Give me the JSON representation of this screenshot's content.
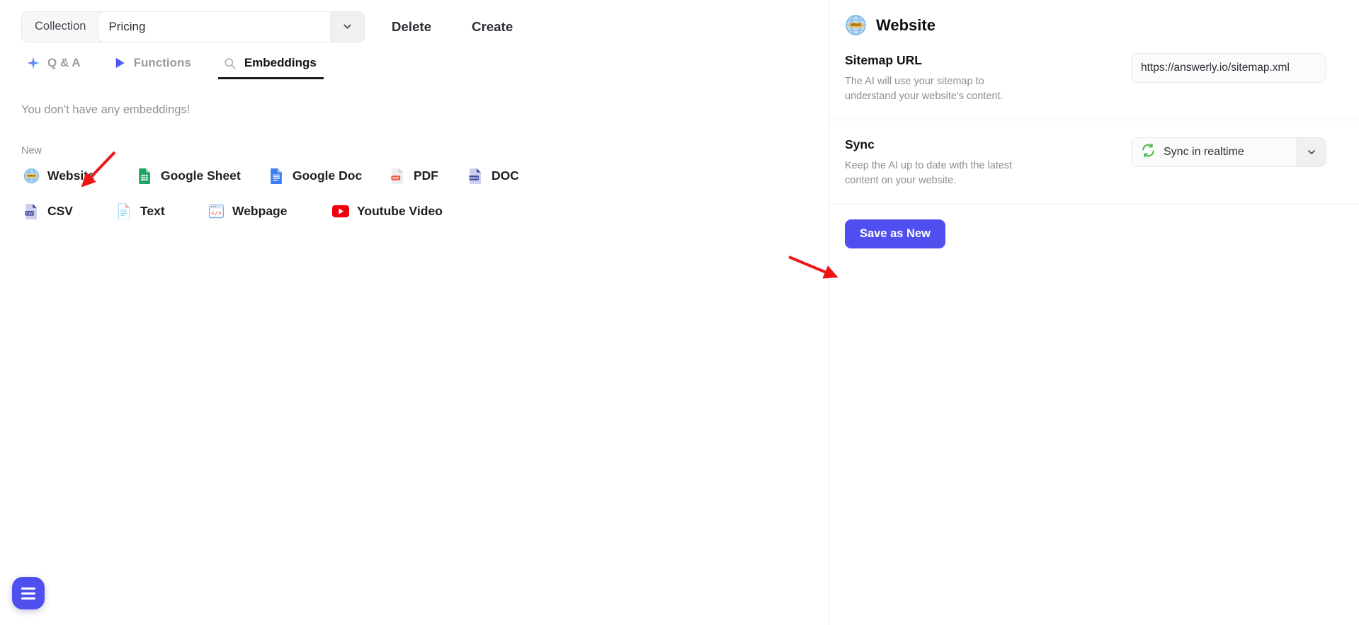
{
  "toolbar": {
    "collection_label": "Collection",
    "collection_value": "Pricing",
    "delete_label": "Delete",
    "create_label": "Create",
    "caret_icon": "chevron-down-icon"
  },
  "tabs": [
    {
      "label": "Q & A",
      "icon": "sparkle-icon",
      "active": false
    },
    {
      "label": "Functions",
      "icon": "play-triangle-icon",
      "active": false
    },
    {
      "label": "Embeddings",
      "icon": "search-icon",
      "active": true
    }
  ],
  "content": {
    "empty_message": "You don't have any embeddings!",
    "new_label": "New"
  },
  "source_types": [
    {
      "label": "Website",
      "icon": "globe-www-icon"
    },
    {
      "label": "Google Sheet",
      "icon": "google-sheet-icon"
    },
    {
      "label": "Google Doc",
      "icon": "google-doc-icon"
    },
    {
      "label": "PDF",
      "icon": "pdf-file-icon",
      "badge": "PDF"
    },
    {
      "label": "DOC",
      "icon": "docx-file-icon",
      "badge": "DOCX"
    },
    {
      "label": "CSV",
      "icon": "csv-file-icon",
      "badge": "CSV"
    },
    {
      "label": "Text",
      "icon": "text-file-icon"
    },
    {
      "label": "Webpage",
      "icon": "code-webpage-icon"
    },
    {
      "label": "Youtube Video",
      "icon": "youtube-icon"
    }
  ],
  "fab": {
    "icon": "hamburger-menu-icon"
  },
  "panel": {
    "title": "Website",
    "icon": "globe-www-icon",
    "sitemap": {
      "title": "Sitemap URL",
      "description": "The AI will use your sitemap to understand your website's content.",
      "value": "https://answerly.io/sitemap.xml",
      "placeholder": "https://answerly.io/sitemap.xml"
    },
    "sync": {
      "title": "Sync",
      "description": "Keep the AI up to date with the latest content on your website.",
      "value": "Sync in realtime",
      "icon": "sync-refresh-icon",
      "caret_icon": "chevron-down-icon"
    },
    "save_label": "Save as New"
  },
  "annotations": [
    {
      "name": "arrow-to-website-item",
      "color": "#f01515"
    },
    {
      "name": "arrow-to-save-button",
      "color": "#f01515"
    }
  ],
  "colors": {
    "accent": "#4f4ff0",
    "arrow": "#f01515",
    "text_primary": "#111216",
    "text_muted": "#8b8e93",
    "panel_border": "#eceef0"
  }
}
